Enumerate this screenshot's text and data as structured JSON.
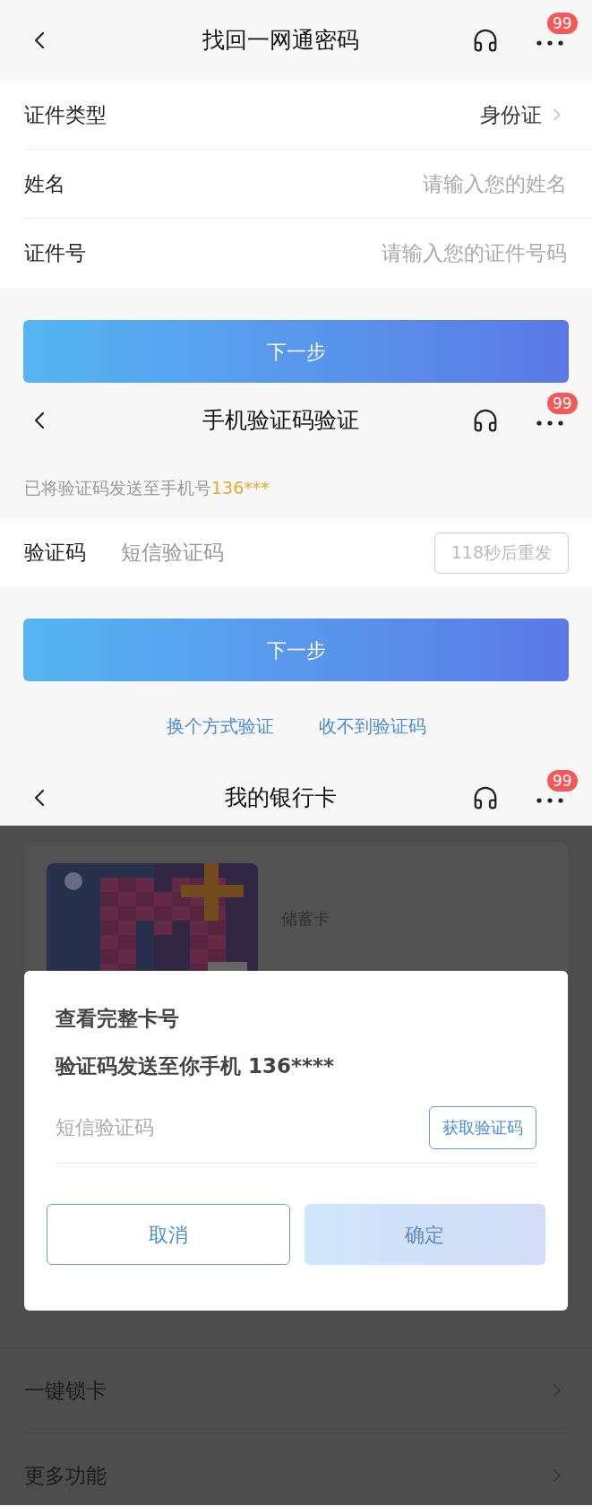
{
  "password_recovery": {
    "header": {
      "title": "找回一网通密码",
      "badge": "99"
    },
    "fields": [
      {
        "kind": "select",
        "label": "证件类型",
        "value": "身份证"
      },
      {
        "kind": "input",
        "label": "姓名",
        "placeholder": "请输入您的姓名"
      },
      {
        "kind": "input",
        "label": "证件号",
        "placeholder": "请输入您的证件号码"
      }
    ],
    "next_button": "下一步"
  },
  "sms_verification": {
    "header": {
      "title": "手机验证码验证",
      "badge": "99"
    },
    "notice": {
      "text": "已将验证码发送至手机号",
      "phone": "136***"
    },
    "code_field": {
      "label": "验证码",
      "placeholder": "短信验证码",
      "resend_button": "118秒后重发",
      "resend_disabled": true
    },
    "next_button": "下一步",
    "links": [
      "换个方式验证",
      "收不到验证码"
    ]
  },
  "bank_cards": {
    "header": {
      "title": "我的银行卡",
      "badge": "99"
    },
    "card": {
      "kind": "picture",
      "type_label": "储蓄卡"
    },
    "menu": [
      "一键锁卡",
      "更多功能"
    ],
    "dialog": {
      "title": "查看完整卡号",
      "subtitle": "验证码发送至你手机 136****",
      "placeholder": "短信验证码",
      "get_code_button": "获取验证码",
      "cancel_button": "取消",
      "confirm_button": "确定",
      "confirm_disabled": true
    }
  }
}
